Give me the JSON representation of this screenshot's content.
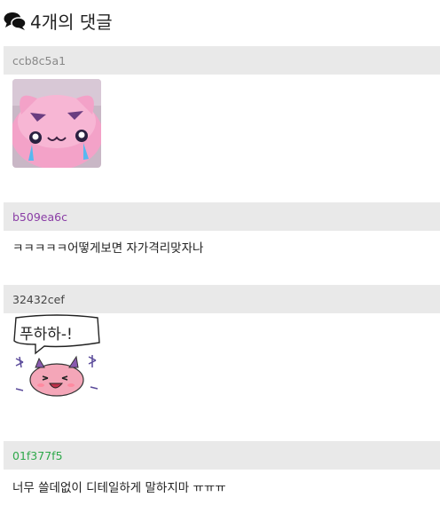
{
  "header": {
    "title": "4개의 댓글",
    "icon": "comments-icon"
  },
  "comments": [
    {
      "author": "ccb8c5a1",
      "author_color": "#888888",
      "type": "sticker",
      "sticker": "pink-crying-slime-sticker"
    },
    {
      "author": "b509ea6c",
      "author_color": "#8a3ea6",
      "type": "text",
      "text": "ㅋㅋㅋㅋㅋ어떻게보면 자가격리맞자나"
    },
    {
      "author": "32432cef",
      "author_color": "#444444",
      "type": "sticker",
      "sticker": "pink-horned-slime-laughing-sticker",
      "sticker_text": "푸하하-!"
    },
    {
      "author": "01f377f5",
      "author_color": "#2ea84a",
      "type": "text",
      "text": "너무 쓸데없이 디테일하게 말하지마 ㅠㅠㅠ"
    }
  ],
  "colors": {
    "comment_header_bg": "#e9e9e9",
    "text": "#222222"
  }
}
